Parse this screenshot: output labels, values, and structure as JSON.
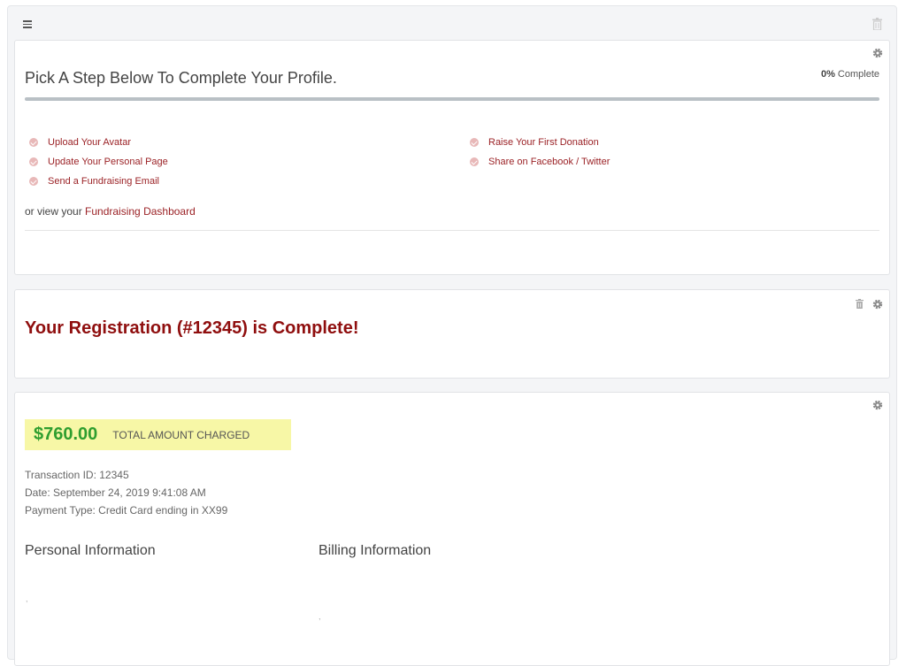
{
  "toolbar": {
    "menu_icon": "hamburger-icon",
    "trash_icon": "trash-icon"
  },
  "profile": {
    "title": "Pick A Step Below To Complete Your Profile.",
    "percent": "0%",
    "percent_suffix": " Complete",
    "progress_fraction": 0,
    "gear_icon": "gear-icon",
    "steps_left": [
      {
        "label": "Upload Your Avatar"
      },
      {
        "label": "Update Your Personal Page"
      },
      {
        "label": "Send a Fundraising Email"
      }
    ],
    "steps_right": [
      {
        "label": "Raise Your First Donation"
      },
      {
        "label": "Share on Facebook / Twitter"
      }
    ],
    "view_prefix": "or view your ",
    "view_link": "Fundraising Dashboard"
  },
  "registration": {
    "title": "Your Registration (#12345) is Complete!"
  },
  "payment": {
    "amount": "$760.00",
    "amount_label": "TOTAL AMOUNT CHARGED",
    "transaction": "Transaction ID: 12345",
    "date": "Date: September 24, 2019 9:41:08 AM",
    "payment_type": "Payment Type: Credit Card ending in XX99",
    "personal_heading": "Personal Information",
    "billing_heading": "Billing Information",
    "personal_value": ",",
    "billing_value": ","
  },
  "colors": {
    "accent": "#9b2226",
    "heading_red": "#8f0e0e",
    "amount_green": "#2f9e2f",
    "highlight": "#f7f7a6"
  }
}
